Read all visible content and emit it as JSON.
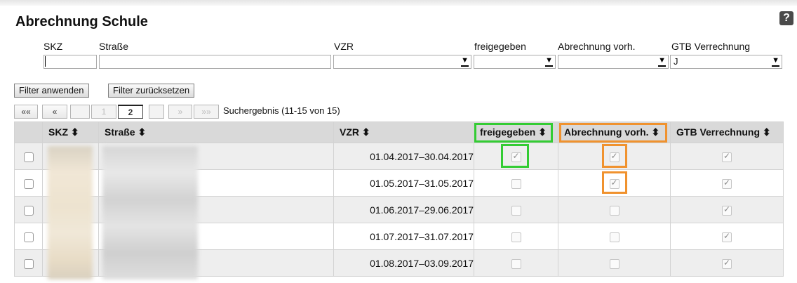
{
  "page": {
    "title": "Abrechnung Schule"
  },
  "help": {
    "icon": "help-icon",
    "glyph": "?"
  },
  "filters": {
    "labels": {
      "skz": "SKZ",
      "strasse": "Straße",
      "vzr": "VZR",
      "freigegeben": "freigegeben",
      "abrechnung": "Abrechnung vorh.",
      "gtb": "GTB Verrechnung"
    },
    "values": {
      "skz": "",
      "strasse": "",
      "vzr": "",
      "freigegeben": "",
      "abrechnung": "",
      "gtb": "J"
    }
  },
  "buttons": {
    "apply": "Filter anwenden",
    "reset": "Filter zurücksetzen"
  },
  "pagination": {
    "first": "««",
    "prev": "«",
    "pages": [
      "1",
      "2"
    ],
    "current_page": "2",
    "next": "»",
    "last": "»»",
    "result_text": "Suchergebnis (11-15 von 15)"
  },
  "table": {
    "headers": {
      "skz": "SKZ ⬍",
      "strasse": "Straße ⬍",
      "vzr": "VZR ⬍",
      "freigegeben": "freigegeben ⬍",
      "abrechnung": "Abrechnung vorh. ⬍",
      "gtb": "GTB Verrechnung ⬍"
    },
    "rows": [
      {
        "vzr": "01.04.2017–30.04.2017",
        "freigegeben": true,
        "abrechnung": true,
        "gtb": true
      },
      {
        "vzr": "01.05.2017–31.05.2017",
        "freigegeben": false,
        "abrechnung": true,
        "gtb": true
      },
      {
        "vzr": "01.06.2017–29.06.2017",
        "freigegeben": false,
        "abrechnung": false,
        "gtb": true
      },
      {
        "vzr": "01.07.2017–31.07.2017",
        "freigegeben": false,
        "abrechnung": false,
        "gtb": true
      },
      {
        "vzr": "01.08.2017–03.09.2017",
        "freigegeben": false,
        "abrechnung": false,
        "gtb": true
      }
    ]
  },
  "colors": {
    "highlight_green": "#33cc33",
    "highlight_orange": "#f0922e",
    "header_bg": "#d9d9d9",
    "row_alt_bg": "#eeeeee"
  }
}
